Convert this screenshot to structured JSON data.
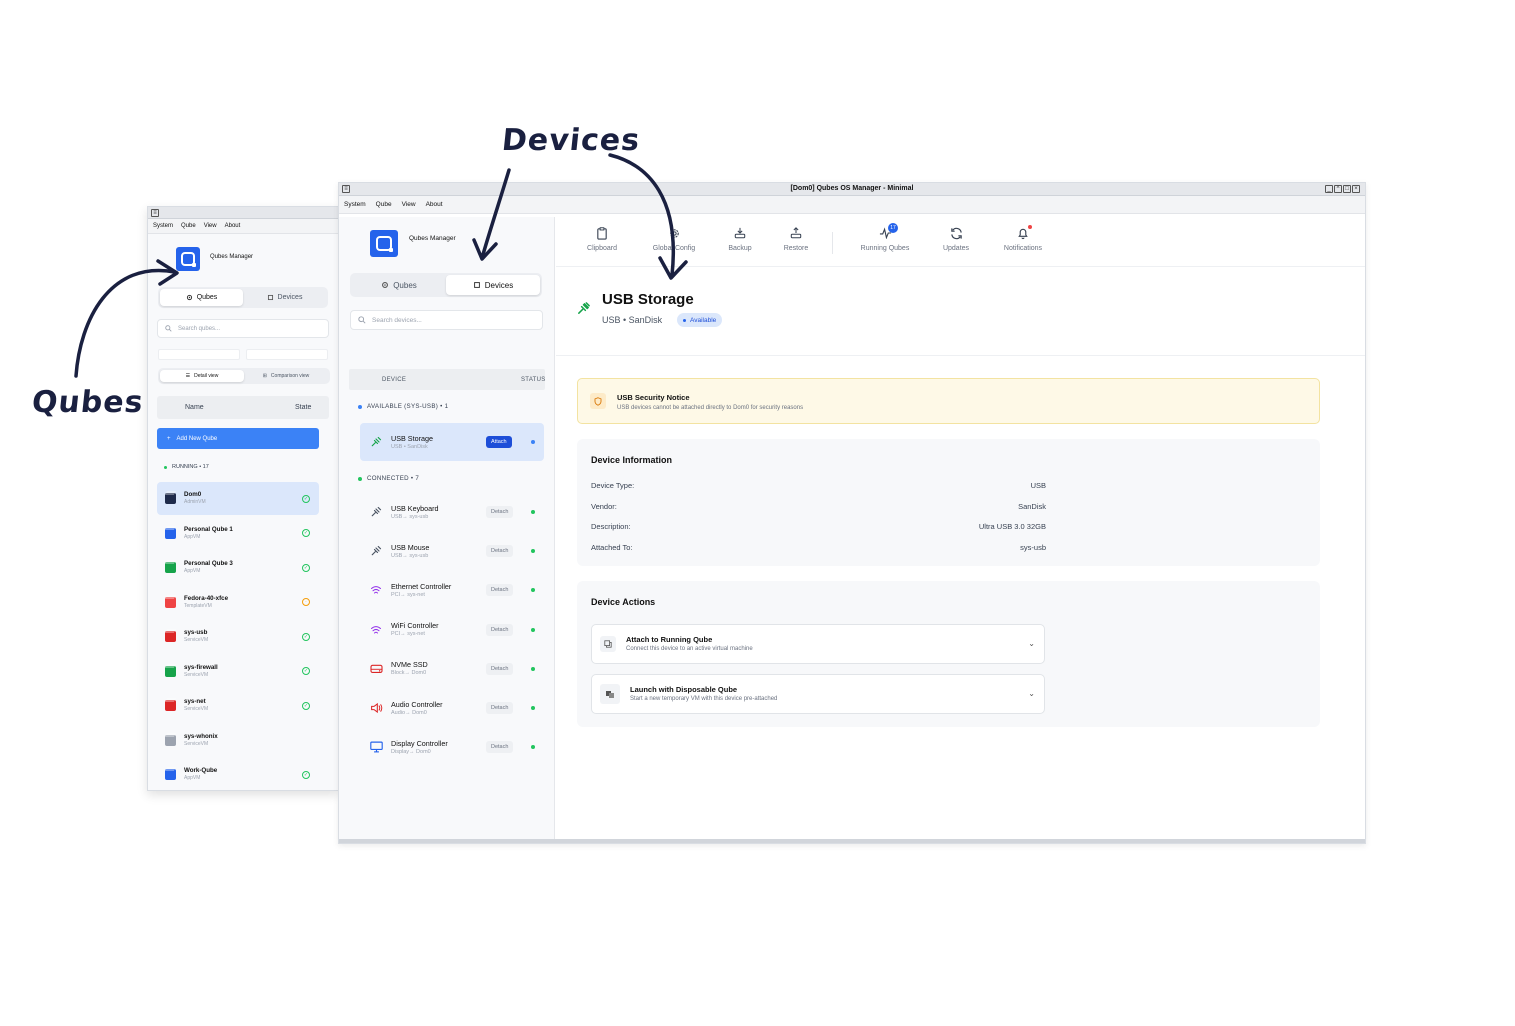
{
  "annotations": {
    "devices": "Devices",
    "qubes": "Qubes"
  },
  "back_window": {
    "menu": [
      "System",
      "Qube",
      "View",
      "About"
    ],
    "brand": "Qubes Manager",
    "tabs": {
      "qubes": "Qubes",
      "devices": "Devices"
    },
    "search_placeholder": "Search qubes...",
    "views": {
      "detail": "Detail view",
      "comparison": "Comparison view"
    },
    "columns": {
      "name": "Name",
      "state": "State"
    },
    "add_button": "Add New Qube",
    "running_header": "RUNNING • 17",
    "qubes": [
      {
        "name": "Dom0",
        "type": "AdminVM",
        "color": "#1e2a4a",
        "state": "running"
      },
      {
        "name": "Personal Qube 1",
        "type": "AppVM",
        "color": "#2563eb",
        "state": "running"
      },
      {
        "name": "Personal Qube 3",
        "type": "AppVM",
        "color": "#16a34a",
        "state": "running"
      },
      {
        "name": "Fedora-40-xfce",
        "type": "TemplateVM",
        "color": "#ef4444",
        "state": "paused"
      },
      {
        "name": "sys-usb",
        "type": "ServiceVM",
        "color": "#dc2626",
        "state": "running"
      },
      {
        "name": "sys-firewall",
        "type": "ServiceVM",
        "color": "#16a34a",
        "state": "running"
      },
      {
        "name": "sys-net",
        "type": "ServiceVM",
        "color": "#dc2626",
        "state": "running"
      },
      {
        "name": "sys-whonix",
        "type": "ServiceVM",
        "color": "#9ca3af",
        "state": "none"
      },
      {
        "name": "Work-Qube",
        "type": "AppVM",
        "color": "#2563eb",
        "state": "running"
      }
    ]
  },
  "front_window": {
    "title": "[Dom0] Qubes OS Manager - Minimal",
    "menu": [
      "System",
      "Qube",
      "View",
      "About"
    ],
    "brand": "Qubes Manager",
    "tabs": {
      "qubes": "Qubes",
      "devices": "Devices"
    },
    "search_placeholder": "Search devices...",
    "columns": {
      "device": "DEVICE",
      "status": "STATUS"
    },
    "available_header": "AVAILABLE (SYS-USB) • 1",
    "connected_header": "CONNECTED • 7",
    "available_devices": [
      {
        "name": "USB Storage",
        "sub": "USB • SanDisk",
        "action": "Attach",
        "icon": "usb-plug-icon",
        "color": "#16a34a"
      }
    ],
    "connected_devices": [
      {
        "name": "USB Keyboard",
        "sub": "USB→ sys-usb",
        "action": "Detach",
        "icon": "usb-plug-icon",
        "color": "#4b5563"
      },
      {
        "name": "USB Mouse",
        "sub": "USB→ sys-usb",
        "action": "Detach",
        "icon": "usb-plug-icon",
        "color": "#4b5563"
      },
      {
        "name": "Ethernet Controller",
        "sub": "PCI→ sys-net",
        "action": "Detach",
        "icon": "wifi-icon",
        "color": "#9333ea"
      },
      {
        "name": "WiFi Controller",
        "sub": "PCI→ sys-net",
        "action": "Detach",
        "icon": "wifi-icon",
        "color": "#9333ea"
      },
      {
        "name": "NVMe SSD",
        "sub": "Block→ Dom0",
        "action": "Detach",
        "icon": "drive-icon",
        "color": "#dc2626"
      },
      {
        "name": "Audio Controller",
        "sub": "Audio→ Dom0",
        "action": "Detach",
        "icon": "speaker-icon",
        "color": "#dc2626"
      },
      {
        "name": "Display Controller",
        "sub": "Display→ Dom0",
        "action": "Detach",
        "icon": "monitor-icon",
        "color": "#2563eb"
      }
    ],
    "toolbar": [
      {
        "label": "Clipboard",
        "icon": "clipboard-icon"
      },
      {
        "label": "Global Config",
        "icon": "gear-icon"
      },
      {
        "label": "Backup",
        "icon": "backup-icon"
      },
      {
        "label": "Restore",
        "icon": "restore-icon"
      },
      {
        "label": "Running Qubes",
        "icon": "activity-icon",
        "badge": "17"
      },
      {
        "label": "Updates",
        "icon": "refresh-icon"
      },
      {
        "label": "Notifications",
        "icon": "bell-icon"
      }
    ],
    "device": {
      "title": "USB Storage",
      "subtitle": "USB • SanDisk",
      "status": "Available",
      "notice_title": "USB Security Notice",
      "notice_text": "USB devices cannot be attached directly to Dom0 for security reasons",
      "info_title": "Device Information",
      "info": [
        {
          "label": "Device Type:",
          "value": "USB"
        },
        {
          "label": "Vendor:",
          "value": "SanDisk"
        },
        {
          "label": "Description:",
          "value": "Ultra USB 3.0 32GB"
        },
        {
          "label": "Attached To:",
          "value": "sys-usb"
        }
      ],
      "actions_title": "Device Actions",
      "actions": [
        {
          "title": "Attach to Running Qube",
          "desc": "Connect this device to an active virtual machine"
        },
        {
          "title": "Launch with Disposable Qube",
          "desc": "Start a new temporary VM with this device pre-attached"
        }
      ]
    },
    "colors": {
      "accent": "#2563eb",
      "notice_bg": "#fef9e7",
      "notice_border": "#f3e3a1"
    }
  }
}
